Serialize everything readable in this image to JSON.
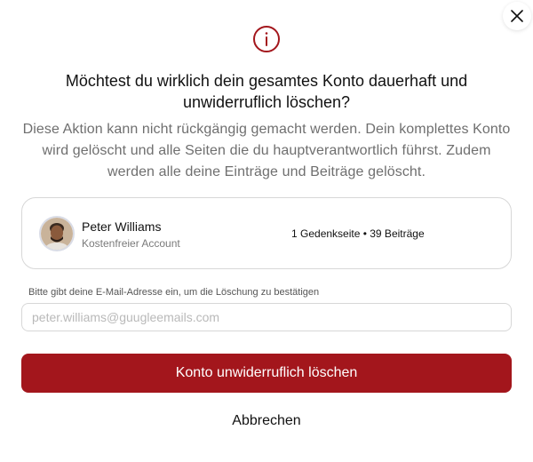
{
  "dialog": {
    "close_icon": "close-icon",
    "warning_icon": "info-circle-icon",
    "title": "Möchtest du wirklich dein gesamtes Konto dauerhaft und unwiderruflich löschen?",
    "description": "Diese Aktion kann nicht rückgängig gemacht werden. Dein komplettes Konto wird gelöscht und alle Seiten die du hauptverantwortlich führst. Zudem werden alle deine Einträge und Beiträge gelöscht."
  },
  "account": {
    "name": "Peter Williams",
    "plan": "Kostenfreier Account",
    "stats": "1 Gedenkseite • 39 Beiträge",
    "avatar": "user-avatar"
  },
  "confirm": {
    "label": "Bitte gibt deine E-Mail-Adresse ein, um die Löschung zu bestätigen",
    "email_value": "",
    "email_placeholder": "peter.williams@guugleemails.com"
  },
  "actions": {
    "delete_label": "Konto unwiderruflich löschen",
    "cancel_label": "Abbrechen"
  },
  "colors": {
    "accent": "#a3161c",
    "text": "#111111",
    "muted": "#6f6f6f",
    "border": "#d7d7d7"
  }
}
